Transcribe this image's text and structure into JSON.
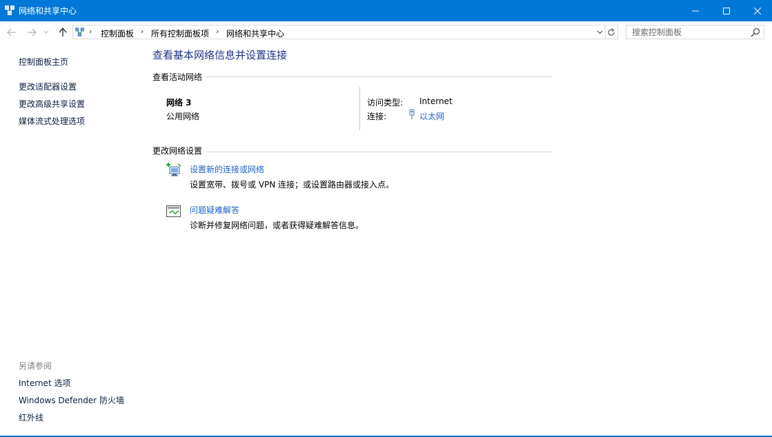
{
  "window": {
    "title": "网络和共享中心",
    "accent_color": "#0078d7",
    "controls": [
      "minimize-icon",
      "maximize-icon",
      "close-icon"
    ]
  },
  "navigation": {
    "back_icon": "arrow-left-icon",
    "forward_icon": "arrow-right-icon",
    "recent_icon": "chevron-down-icon",
    "up_icon": "arrow-up-icon",
    "breadcrumbs": [
      "控制面板",
      "所有控制面板项",
      "网络和共享中心"
    ],
    "refresh_icon": "refresh-icon",
    "search": {
      "placeholder": "搜索控制面板",
      "value": ""
    }
  },
  "sidebar": {
    "home": "控制面板主页",
    "links": [
      "更改适配器设置",
      "更改高级共享设置",
      "媒体流式处理选项"
    ],
    "see_also_heading": "另请参阅",
    "see_also": [
      "Internet 选项",
      "Windows Defender 防火墙",
      "红外线"
    ]
  },
  "main": {
    "title": "查看基本网络信息并设置连接",
    "active_networks_heading": "查看活动网络",
    "network": {
      "name": "网络 3",
      "category": "公用网络",
      "access_type_label": "访问类型:",
      "access_type_value": "Internet",
      "connection_label": "连接:",
      "connection_value": "以太网"
    },
    "change_settings_heading": "更改网络设置",
    "tasks": [
      {
        "icon": "new-connection-icon",
        "link": "设置新的连接或网络",
        "description": "设置宽带、拨号或 VPN 连接；或设置路由器或接入点。"
      },
      {
        "icon": "troubleshoot-icon",
        "link": "问题疑难解答",
        "description": "诊断并修复网络问题，或者获得疑难解答信息。"
      }
    ]
  },
  "colors": {
    "link": "#1e64c8",
    "title_text": "#1e3287",
    "muted": "#808080"
  }
}
